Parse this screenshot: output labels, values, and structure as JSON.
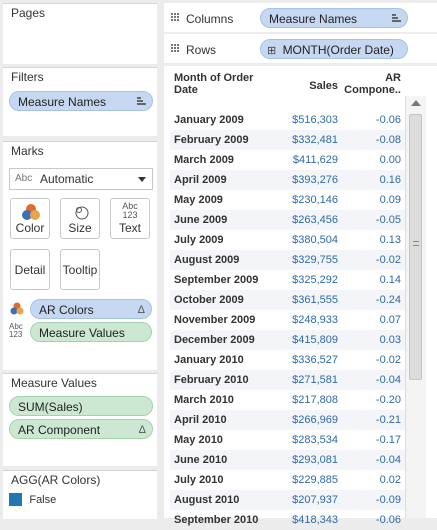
{
  "pages": {
    "title": "Pages"
  },
  "filters": {
    "title": "Filters",
    "pill": "Measure Names"
  },
  "marks": {
    "title": "Marks",
    "mark_type_prefix": "Abc",
    "mark_type": "Automatic",
    "buttons": {
      "color": "Color",
      "size": "Size",
      "text": "Text",
      "text_icon_top": "Abc",
      "text_icon_bottom": "123",
      "detail": "Detail",
      "tooltip": "Tooltip"
    },
    "fields": [
      {
        "name": "AR Colors",
        "tail": "Δ"
      },
      {
        "name": "Measure Values",
        "icon_top": "Abc",
        "icon_bottom": "123"
      }
    ]
  },
  "measure_values": {
    "title": "Measure Values",
    "items": [
      {
        "name": "SUM(Sales)",
        "tail": ""
      },
      {
        "name": "AR Component",
        "tail": "Δ"
      }
    ]
  },
  "legend": {
    "title": "AGG(AR Colors)",
    "item": "False",
    "swatch_color": "#1f77b4"
  },
  "shelves": {
    "columns_label": "Columns",
    "columns_pill": "Measure Names",
    "rows_label": "Rows",
    "rows_pill": "MONTH(Order Date)",
    "rows_pill_prefix": "⊞"
  },
  "table": {
    "headers": {
      "month": "Month of Order Date",
      "sales": "Sales",
      "ar": "AR Compone.."
    },
    "rows": [
      [
        "January 2009",
        "$516,303",
        "-0.06"
      ],
      [
        "February 2009",
        "$332,481",
        "-0.08"
      ],
      [
        "March 2009",
        "$411,629",
        "0.00"
      ],
      [
        "April 2009",
        "$393,276",
        "0.16"
      ],
      [
        "May 2009",
        "$230,146",
        "0.09"
      ],
      [
        "June 2009",
        "$263,456",
        "-0.05"
      ],
      [
        "July 2009",
        "$380,504",
        "0.13"
      ],
      [
        "August 2009",
        "$329,755",
        "-0.02"
      ],
      [
        "September 2009",
        "$325,292",
        "0.14"
      ],
      [
        "October 2009",
        "$361,555",
        "-0.24"
      ],
      [
        "November 2009",
        "$248,933",
        "0.07"
      ],
      [
        "December 2009",
        "$415,809",
        "0.03"
      ],
      [
        "January 2010",
        "$336,527",
        "-0.02"
      ],
      [
        "February 2010",
        "$271,581",
        "-0.04"
      ],
      [
        "March 2010",
        "$217,808",
        "-0.20"
      ],
      [
        "April 2010",
        "$266,969",
        "-0.21"
      ],
      [
        "May 2010",
        "$283,534",
        "-0.17"
      ],
      [
        "June 2010",
        "$293,081",
        "-0.04"
      ],
      [
        "July 2010",
        "$229,885",
        "0.02"
      ],
      [
        "August 2010",
        "$207,937",
        "-0.09"
      ],
      [
        "September 2010",
        "$418,343",
        "-0.06"
      ]
    ]
  }
}
